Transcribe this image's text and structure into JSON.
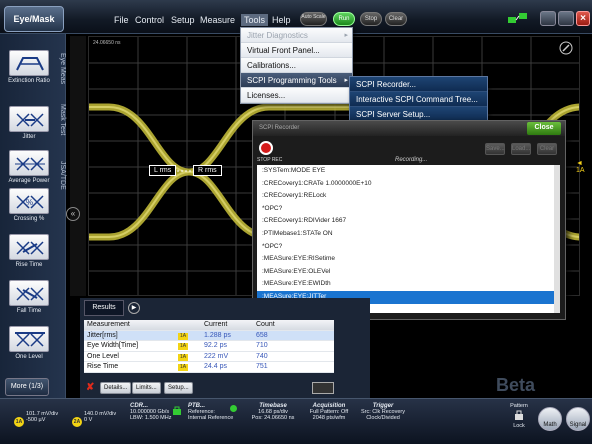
{
  "app": {
    "logo": "Eye/Mask"
  },
  "menubar": {
    "items": [
      "File",
      "Control",
      "Setup",
      "Measure",
      "Tools",
      "Help"
    ],
    "auto_scale": "Auto Scale",
    "run": "Run",
    "stop": "Stop",
    "clear": "Clear"
  },
  "left_toolbar": {
    "tools": [
      "Extinction Ratio",
      "Jitter",
      "Average Power",
      "Crossing %",
      "Rise Time",
      "Fall Time",
      "One Level"
    ],
    "more": "More (1/3)",
    "tabs": [
      "Eye Meas",
      "Mask Test",
      "JSA/TDE"
    ]
  },
  "scope": {
    "timebase_label": "24.06650 ns",
    "markers": [
      "L rms",
      "R rms"
    ],
    "channel_marker": "◄ 1A"
  },
  "tools_menu": {
    "items": [
      {
        "label": "Jitter Diagnostics",
        "disabled": true,
        "submenu": true
      },
      {
        "label": "Virtual Front Panel...",
        "disabled": false,
        "submenu": false
      },
      {
        "label": "Calibrations...",
        "disabled": false,
        "submenu": false
      },
      {
        "label": "SCPI Programming Tools",
        "disabled": false,
        "submenu": true,
        "highlighted": true
      },
      {
        "label": "Licenses...",
        "disabled": false,
        "submenu": false
      }
    ]
  },
  "scpi_submenu": {
    "items": [
      "SCPI Recorder...",
      "Interactive SCPI Command Tree...",
      "SCPI Server Setup..."
    ]
  },
  "recorder": {
    "title": "SCPI Recorder",
    "help": "?",
    "close": "Close",
    "stop_label": "STOP REC",
    "status": "Recording...",
    "buttons": [
      "Save...",
      "Load...",
      "Clear"
    ],
    "commands": [
      ":SYSTem:MODE EYE",
      ":CRECovery1:CRATe 1.0000000E+10",
      ":CRECovery1:RELock",
      "*OPC?",
      ":CRECovery1:RDIVider 1667",
      ":PTIMebase1:STATe ON",
      "*OPC?",
      ":MEASure:EYE:RISetime",
      ":MEASure:EYE:OLEVel",
      ":MEASure:EYE:EWIDth",
      ":MEASure:EYE:JITTer"
    ],
    "selected_index": 10
  },
  "results": {
    "tab": "Results",
    "headers": [
      "Measurement",
      "",
      "Current",
      "Count"
    ],
    "rows": [
      {
        "name": "Jitter[rms]",
        "ch": "1A",
        "current": "1.288 ps",
        "count": "658"
      },
      {
        "name": "Eye Width[Time]",
        "ch": "1A",
        "current": "92.2 ps",
        "count": "710"
      },
      {
        "name": "One Level",
        "ch": "1A",
        "current": "222 mV",
        "count": "740"
      },
      {
        "name": "Rise Time",
        "ch": "1A",
        "current": "24.4 ps",
        "count": "751"
      }
    ],
    "buttons": [
      "Details...",
      "Limits...",
      "Setup..."
    ]
  },
  "statusbar": {
    "ch1": {
      "id": "1A",
      "line1": "101.7 mV/div",
      "line2": "-500 µV"
    },
    "ch2": {
      "id": "2A",
      "line1": "140.0 mV/div",
      "line2": "0 V"
    },
    "cdr": {
      "title": "CDR...",
      "line1": "10.000000 Gb/s",
      "line2": "LBW: 1.500 MHz"
    },
    "ptb": {
      "title": "PTB...",
      "line1": "Reference:",
      "line2": "Internal Reference"
    },
    "timebase": {
      "title": "Timebase",
      "line1": "16.68 ps/div",
      "line2": "Pos: 24.06650 ns"
    },
    "acquisition": {
      "title": "Acquisition",
      "line1": "Full Pattern: Off",
      "line2": "2048 pts/wfm"
    },
    "trigger": {
      "title": "Trigger",
      "line1": "Src: Clk Recovery",
      "line2": "Clock/Divided"
    },
    "pattern": {
      "title": "Pattern",
      "line2": "Lock"
    },
    "math": "Math",
    "signal": "Signal"
  },
  "watermark": "Beta",
  "colors": {
    "eye": "#c9c13a",
    "accent": "#1a74d0",
    "run": "#2ea42e"
  }
}
